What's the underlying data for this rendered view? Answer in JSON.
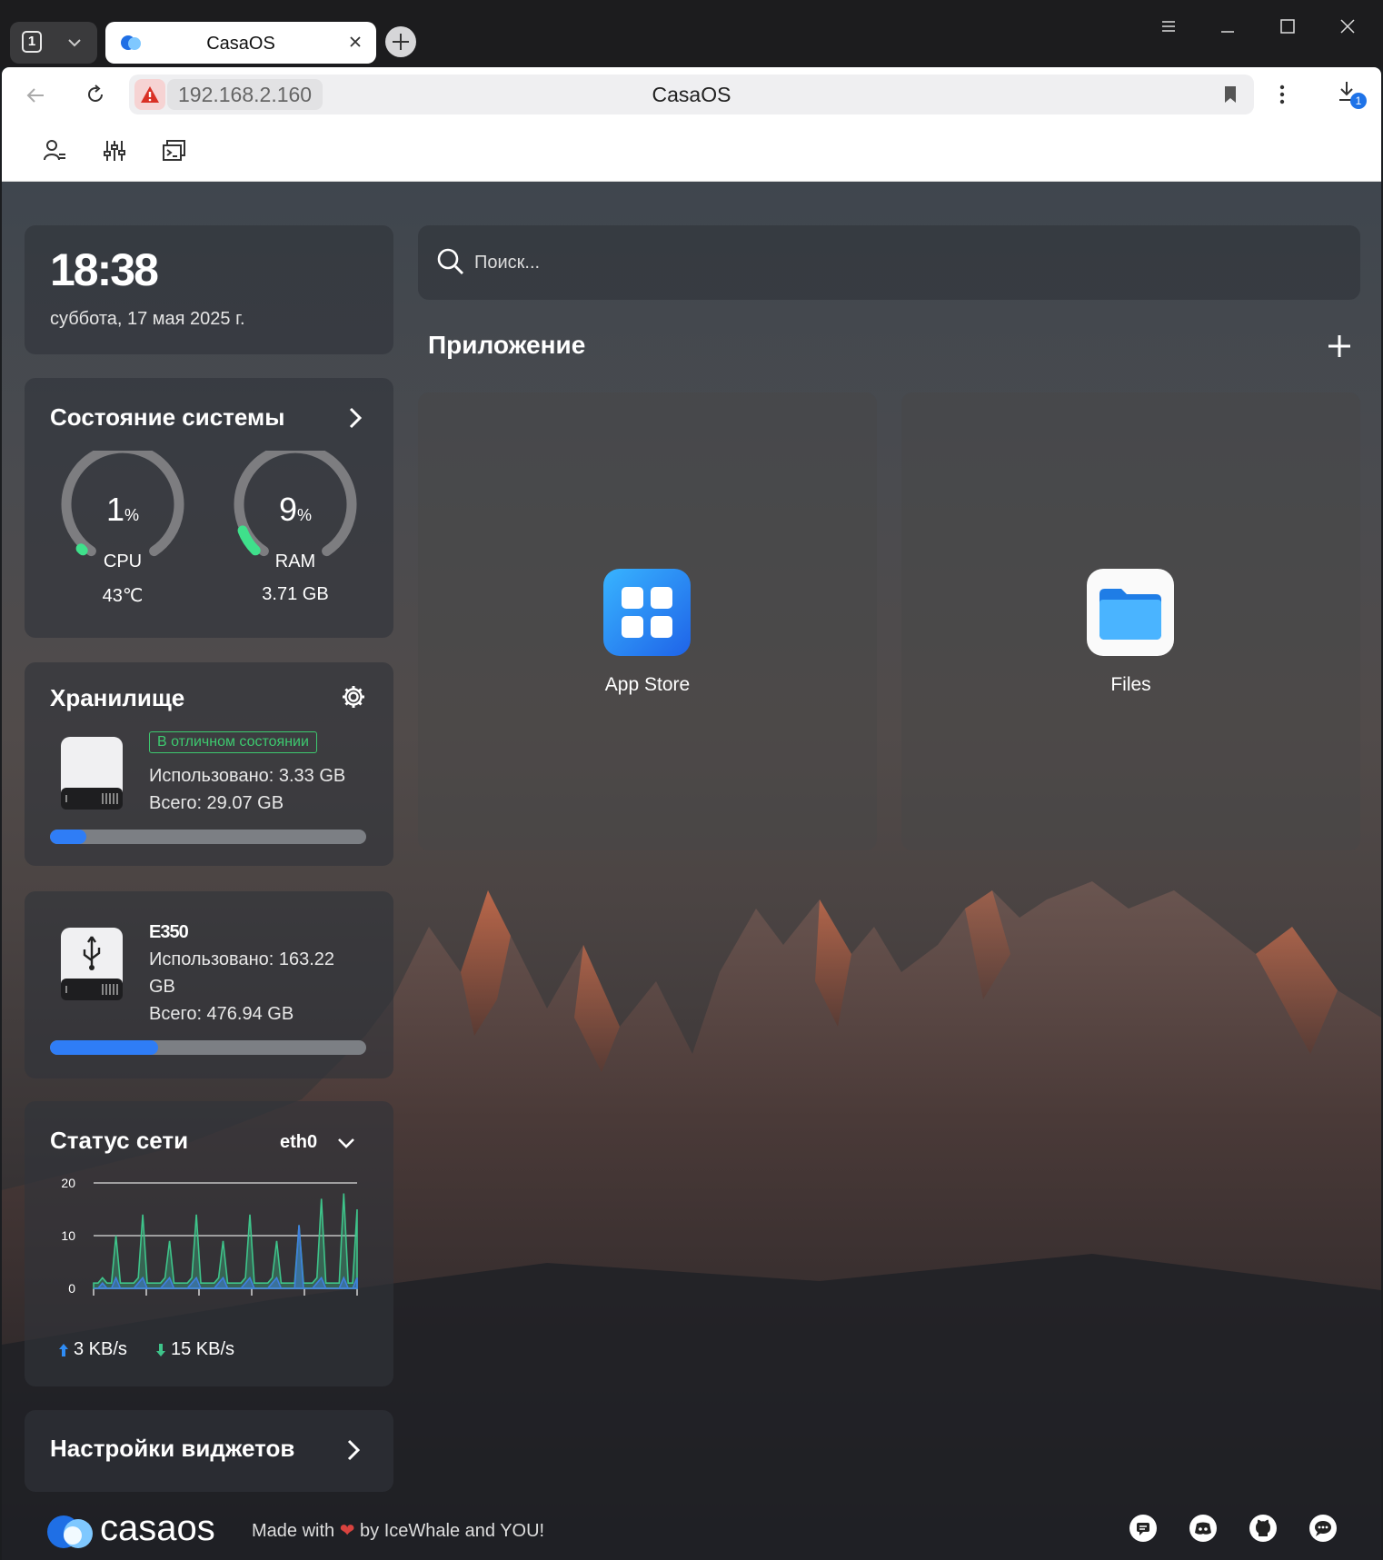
{
  "browser": {
    "tab_count": "1",
    "tab_title": "CasaOS",
    "address_ip": "192.168.2.160",
    "address_title": "CasaOS",
    "downloads_badge": "1"
  },
  "clock": {
    "time": "18:38",
    "date": "суббота, 17 мая 2025 г."
  },
  "system": {
    "title": "Состояние системы",
    "cpu": {
      "value": "1",
      "unit": "%",
      "label": "CPU",
      "sub": "43℃",
      "percent": 1
    },
    "ram": {
      "value": "9",
      "unit": "%",
      "label": "RAM",
      "sub": "3.71 GB",
      "percent": 9
    }
  },
  "storage": {
    "title": "Хранилище",
    "status": "В отличном состоянии",
    "used": "Использовано: 3.33 GB",
    "total": "Всего: 29.07 GB",
    "fill_percent": 11.5
  },
  "usb": {
    "name": "E350",
    "used_line1": "Использовано: 163.22",
    "used_line2": "GB",
    "total": "Всего: 476.94 GB",
    "fill_percent": 34.2
  },
  "network": {
    "title": "Статус сети",
    "interface": "eth0",
    "y_ticks": [
      "20",
      "10",
      "0"
    ],
    "upload": "3 KB/s",
    "download": "15 KB/s"
  },
  "widgets": {
    "title": "Настройки виджетов"
  },
  "search": {
    "placeholder": "Поиск..."
  },
  "apps": {
    "title": "Приложение",
    "items": [
      {
        "name": "App Store",
        "color": "#2f8cf5"
      },
      {
        "name": "Files",
        "color": "#ffffff"
      }
    ]
  },
  "footer": {
    "brand": "casaos",
    "made_prefix": "Made with",
    "made_suffix": "by IceWhale and YOU!"
  },
  "chart_data": {
    "type": "area",
    "x": [
      0,
      1,
      2,
      3,
      4,
      5,
      6,
      7,
      8,
      9,
      10,
      11,
      12,
      13,
      14,
      15,
      16,
      17,
      18,
      19,
      20,
      21,
      22,
      23,
      24,
      25,
      26,
      27,
      28,
      29,
      30,
      31,
      32,
      33,
      34,
      35,
      36,
      37,
      38,
      39,
      40,
      41,
      42,
      43,
      44,
      45,
      46,
      47,
      48,
      49,
      50,
      51,
      52,
      53,
      54,
      55,
      56,
      57,
      58,
      59
    ],
    "series": [
      {
        "name": "",
        "color": "#3ec48a",
        "values": [
          1,
          1,
          2,
          1,
          1,
          10,
          1,
          1,
          1,
          1,
          2,
          14,
          1,
          1,
          1,
          1,
          2,
          9,
          1,
          1,
          1,
          1,
          2,
          14,
          1,
          1,
          1,
          1,
          2,
          9,
          1,
          1,
          1,
          1,
          2,
          14,
          1,
          1,
          1,
          1,
          2,
          9,
          1,
          1,
          1,
          1,
          12,
          1,
          1,
          1,
          2,
          17,
          1,
          1,
          1,
          1,
          18,
          1,
          1,
          15
        ]
      },
      {
        "name": "",
        "color": "#3f7fe0",
        "values": [
          0,
          0,
          1,
          0,
          0,
          2,
          0,
          0,
          0,
          0,
          1,
          2,
          0,
          0,
          0,
          0,
          1,
          2,
          0,
          0,
          0,
          0,
          1,
          2,
          0,
          0,
          0,
          0,
          1,
          2,
          0,
          0,
          0,
          0,
          1,
          2,
          0,
          0,
          0,
          0,
          1,
          2,
          0,
          0,
          0,
          0,
          12,
          0,
          0,
          0,
          1,
          2,
          0,
          0,
          0,
          0,
          2,
          0,
          0,
          2
        ]
      }
    ],
    "ylim": [
      0,
      20
    ],
    "y_ticks": [
      0,
      10,
      20
    ],
    "grid": true
  }
}
